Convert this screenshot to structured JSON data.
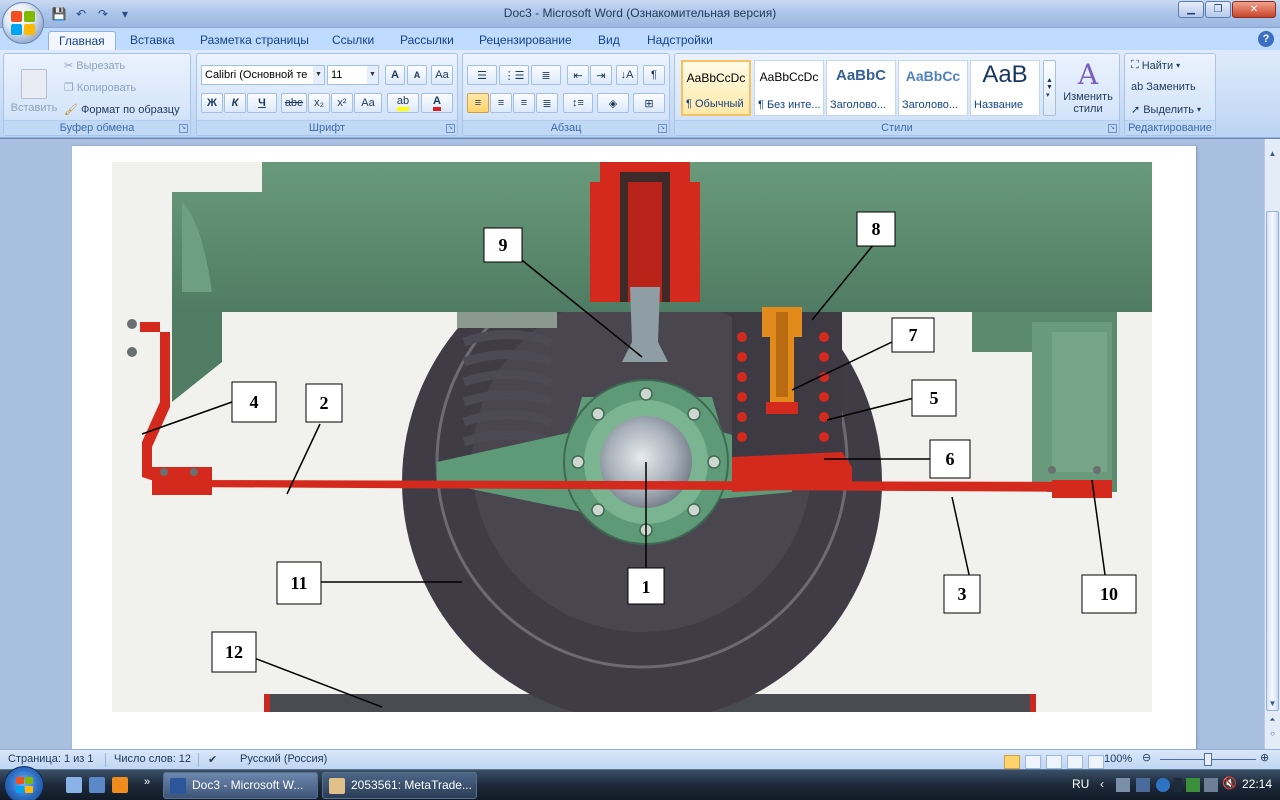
{
  "window": {
    "title": "Doc3 - Microsoft Word (Ознакомительная версия)"
  },
  "tabs": [
    {
      "label": "Главная",
      "active": true
    },
    {
      "label": "Вставка"
    },
    {
      "label": "Разметка страницы"
    },
    {
      "label": "Ссылки"
    },
    {
      "label": "Рассылки"
    },
    {
      "label": "Рецензирование"
    },
    {
      "label": "Вид"
    },
    {
      "label": "Надстройки"
    }
  ],
  "ribbon": {
    "clipboard": {
      "label": "Буфер обмена",
      "paste": "Вставить",
      "cut": "Вырезать",
      "copy": "Копировать",
      "format_painter": "Формат по образцу"
    },
    "font": {
      "label": "Шрифт",
      "font_name": "Calibri (Основной те",
      "font_size": "11",
      "bold": "Ж",
      "italic": "К",
      "underline": "Ч",
      "strike": "abe",
      "subscript": "x₂",
      "superscript": "x²",
      "change_case": "Aa",
      "grow": "A",
      "shrink": "A"
    },
    "paragraph": {
      "label": "Абзац",
      "show_marks": "¶"
    },
    "styles": {
      "label": "Стили",
      "items": [
        {
          "sample": "AaBbCcDc",
          "name": "¶ Обычный",
          "selected": true
        },
        {
          "sample": "AaBbCcDc",
          "name": "¶ Без инте..."
        },
        {
          "sample": "AaBbC",
          "name": "Заголово..."
        },
        {
          "sample": "AaBbCc",
          "name": "Заголово..."
        },
        {
          "sample": "AaB",
          "name": "Название"
        }
      ],
      "change_styles_1": "Изменить",
      "change_styles_2": "стили"
    },
    "editing": {
      "label": "Редактирование",
      "find": "Найти",
      "replace": "Заменить",
      "select": "Выделить"
    }
  },
  "figure": {
    "callouts": [
      "1",
      "2",
      "3",
      "4",
      "5",
      "6",
      "7",
      "8",
      "9",
      "10",
      "11",
      "12"
    ]
  },
  "statusbar": {
    "page": "Страница: 1 из 1",
    "words": "Число слов: 12",
    "language": "Русский (Россия)",
    "zoom": "100%"
  },
  "taskbar": {
    "items": [
      {
        "label": "Doc3 - Microsoft W..."
      },
      {
        "label": "2053561: MetaTrade..."
      }
    ],
    "lang": "RU",
    "time": "22:14"
  },
  "colors": {
    "ribbon_blue": "#bfdbff",
    "frame_green": "#5e8b6f",
    "brake_red": "#d42a1e",
    "wheel_dark": "#3f3c46"
  }
}
